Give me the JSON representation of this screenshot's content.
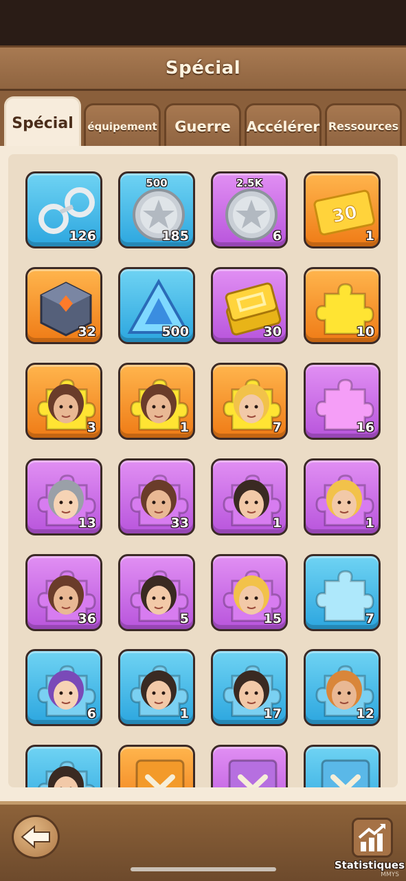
{
  "header": {
    "title": "Spécial"
  },
  "tabs": [
    {
      "label": "Spécial",
      "active": true
    },
    {
      "label": "équipement",
      "active": false
    },
    {
      "label": "Guerre",
      "active": false
    },
    {
      "label": "Accélérer",
      "active": false
    },
    {
      "label": "Ressources",
      "active": false
    }
  ],
  "items": [
    {
      "name": "handcuffs",
      "icon": "handcuffs-icon",
      "rarity": "blue",
      "qty": "126",
      "top_label": ""
    },
    {
      "name": "silver-coin-500",
      "icon": "silver-star-coin-icon",
      "rarity": "blue",
      "qty": "185",
      "top_label": "500"
    },
    {
      "name": "silver-coin-2-5k",
      "icon": "silver-star-coin-icon",
      "rarity": "purple",
      "qty": "6",
      "top_label": "2.5K"
    },
    {
      "name": "ticket-30",
      "icon": "gold-ticket-30-icon",
      "rarity": "orange",
      "qty": "1",
      "top_label": ""
    },
    {
      "name": "mystic-cube",
      "icon": "cube-icon",
      "rarity": "orange",
      "qty": "32",
      "top_label": ""
    },
    {
      "name": "blue-crystal",
      "icon": "blue-crystal-icon",
      "rarity": "blue",
      "qty": "500",
      "top_label": ""
    },
    {
      "name": "gold-bars",
      "icon": "gold-bars-icon",
      "rarity": "purple",
      "qty": "30",
      "top_label": ""
    },
    {
      "name": "gold-puzzle",
      "icon": "gold-puzzle-icon",
      "rarity": "orange",
      "qty": "10",
      "top_label": ""
    },
    {
      "name": "hero-shard-blonde-1",
      "icon": "hero-shard-icon",
      "rarity": "orange",
      "qty": "3",
      "top_label": ""
    },
    {
      "name": "hero-shard-blonde-2",
      "icon": "hero-shard-icon",
      "rarity": "orange",
      "qty": "1",
      "top_label": ""
    },
    {
      "name": "hero-shard-glasses",
      "icon": "hero-shard-icon",
      "rarity": "orange",
      "qty": "7",
      "top_label": ""
    },
    {
      "name": "purple-puzzle",
      "icon": "purple-puzzle-icon",
      "rarity": "purple",
      "qty": "16",
      "top_label": ""
    },
    {
      "name": "hero-shard-violet",
      "icon": "hero-shard-icon",
      "rarity": "purple",
      "qty": "13",
      "top_label": ""
    },
    {
      "name": "hero-shard-gangster",
      "icon": "hero-shard-icon",
      "rarity": "purple",
      "qty": "33",
      "top_label": ""
    },
    {
      "name": "hero-shard-gray",
      "icon": "hero-shard-icon",
      "rarity": "purple",
      "qty": "1",
      "top_label": ""
    },
    {
      "name": "hero-shard-redhead",
      "icon": "hero-shard-icon",
      "rarity": "purple",
      "qty": "1",
      "top_label": ""
    },
    {
      "name": "hero-shard-brunette",
      "icon": "hero-shard-icon",
      "rarity": "purple",
      "qty": "36",
      "top_label": ""
    },
    {
      "name": "hero-shard-boss",
      "icon": "hero-shard-icon",
      "rarity": "purple",
      "qty": "5",
      "top_label": ""
    },
    {
      "name": "hero-shard-bearded",
      "icon": "hero-shard-icon",
      "rarity": "purple",
      "qty": "15",
      "top_label": ""
    },
    {
      "name": "blue-puzzle",
      "icon": "blue-puzzle-icon",
      "rarity": "blue",
      "qty": "7",
      "top_label": ""
    },
    {
      "name": "hero-shard-dark-hair",
      "icon": "hero-shard-icon",
      "rarity": "blue",
      "qty": "6",
      "top_label": ""
    },
    {
      "name": "hero-shard-thug",
      "icon": "hero-shard-icon",
      "rarity": "blue",
      "qty": "1",
      "top_label": ""
    },
    {
      "name": "hero-shard-beard-blue",
      "icon": "hero-shard-icon",
      "rarity": "blue",
      "qty": "17",
      "top_label": ""
    },
    {
      "name": "hero-shard-blonde-blue",
      "icon": "hero-shard-icon",
      "rarity": "blue",
      "qty": "12",
      "top_label": ""
    },
    {
      "name": "hero-shard-pink",
      "icon": "hero-shard-icon",
      "rarity": "blue",
      "qty": "",
      "top_label": ""
    },
    {
      "name": "orange-book",
      "icon": "book-icon",
      "rarity": "orange",
      "qty": "",
      "top_label": ""
    },
    {
      "name": "purple-book",
      "icon": "book-icon",
      "rarity": "purple",
      "qty": "",
      "top_label": ""
    },
    {
      "name": "blue-book",
      "icon": "book-icon",
      "rarity": "blue",
      "qty": "",
      "top_label": ""
    }
  ],
  "bottom": {
    "stats_label": "Statistiques",
    "watermark": "MMYS"
  },
  "colors": {
    "wood": "#8f6440",
    "panel": "#f5ead9",
    "blue": "#2ca6df",
    "purple": "#b855dc",
    "orange": "#ef7b16"
  }
}
